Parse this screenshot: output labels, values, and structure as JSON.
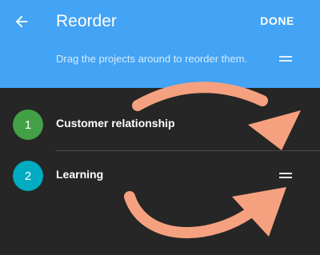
{
  "header": {
    "title": "Reorder",
    "done_label": "DONE",
    "hint": "Drag the projects around to reorder them.",
    "back_icon": "arrow-back-icon",
    "handle_icon": "drag-handle-icon"
  },
  "projects": [
    {
      "number": "1",
      "name": "Customer relationship",
      "color": "#43a047"
    },
    {
      "number": "2",
      "name": "Learning",
      "color": "#00acc1"
    }
  ],
  "colors": {
    "app_bar": "#43a3f4",
    "background": "#262626",
    "annotation_arrows": "#f5a17f"
  }
}
